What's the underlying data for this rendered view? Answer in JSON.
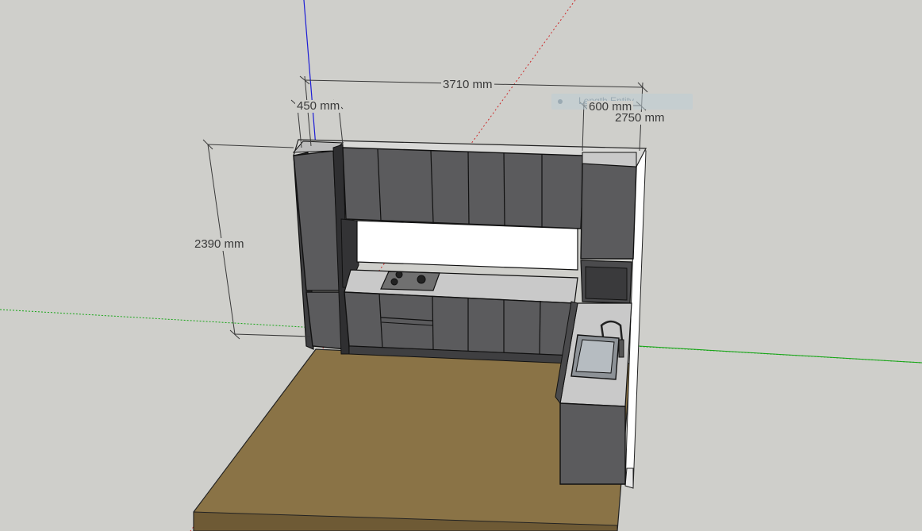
{
  "viewport": {
    "background": "#cfcfcb",
    "axis_colors": {
      "x": "#16a516",
      "y": "#cc2a2a",
      "z": "#1d1dd6"
    }
  },
  "model": {
    "cabinet_color": "#5b5b5d",
    "countertop_color": "#c9c9c9",
    "floor_color": "#8a7346",
    "backsplash_color": "#ffffff"
  },
  "dimensions": {
    "total_width": "3710 mm",
    "tall_cabinet_width": "450 mm",
    "right_cabinet_width": "600 mm",
    "depth": "2750 mm",
    "height": "2390 mm"
  },
  "tooltip": {
    "text": "Length Entity"
  }
}
